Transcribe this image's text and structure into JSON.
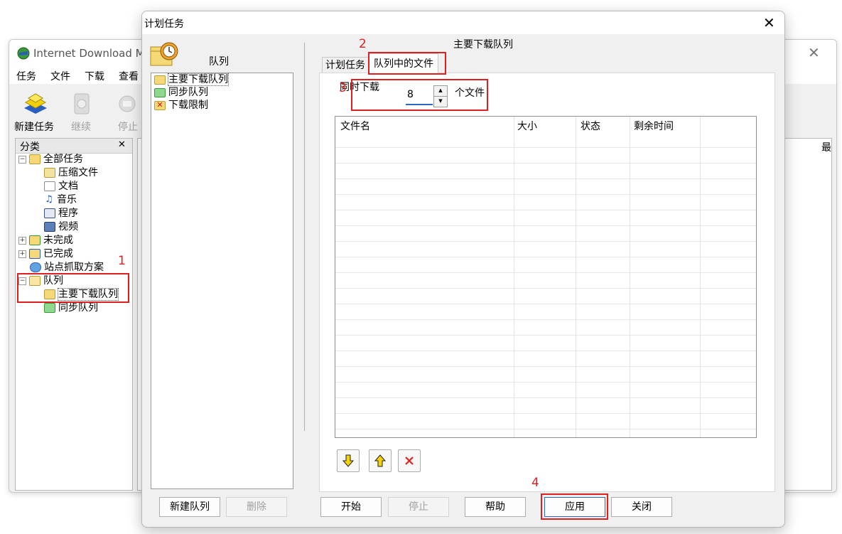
{
  "bg_window": {
    "title": "Internet Download M",
    "menu": [
      "任务",
      "文件",
      "下载",
      "查看"
    ],
    "toolbar": [
      {
        "label": "新建任务",
        "icon": "new-task-icon"
      },
      {
        "label": "继续",
        "icon": "resume-icon"
      },
      {
        "label": "停止",
        "icon": "stop-icon"
      }
    ],
    "category_header": "分类",
    "category_close": "✕",
    "list_head_glyph": "最",
    "tree": [
      {
        "label": "全部任务",
        "icon": "open-folder-icon"
      },
      {
        "label": "压缩文件",
        "icon": "zip-file-icon"
      },
      {
        "label": "文档",
        "icon": "document-icon"
      },
      {
        "label": "音乐",
        "icon": "music-icon"
      },
      {
        "label": "程序",
        "icon": "program-icon"
      },
      {
        "label": "视频",
        "icon": "video-icon"
      },
      {
        "label": "未完成",
        "icon": "unfinished-folder-icon"
      },
      {
        "label": "已完成",
        "icon": "finished-folder-icon"
      },
      {
        "label": "站点抓取方案",
        "icon": "site-grabber-icon"
      },
      {
        "label": "队列",
        "icon": "queue-folder-icon"
      },
      {
        "label": "主要下载队列",
        "icon": "main-queue-icon"
      },
      {
        "label": "同步队列",
        "icon": "sync-queue-icon"
      }
    ]
  },
  "dialog": {
    "title": "计划任务",
    "close_glyph": "✕",
    "queue_label": "队列",
    "queues": [
      {
        "label": "主要下载队列",
        "icon": "main-queue-icon"
      },
      {
        "label": "同步队列",
        "icon": "sync-queue-icon"
      },
      {
        "label": "下载限制",
        "icon": "download-limit-icon"
      }
    ],
    "new_queue_btn": "新建队列",
    "delete_btn": "删除",
    "main_title": "主要下载队列",
    "tabs": [
      "计划任务",
      "队列中的文件"
    ],
    "concurrent_label": "同时下载",
    "concurrent_value": "8",
    "concurrent_unit": "个文件",
    "columns": [
      "文件名",
      "大小",
      "状态",
      "剩余时间"
    ],
    "buttons": {
      "start": "开始",
      "stop": "停止",
      "help": "帮助",
      "apply": "应用",
      "close": "关闭"
    }
  },
  "annotations": [
    "1",
    "2",
    "3",
    "4"
  ],
  "colors": {
    "annotation": "#e02020",
    "focus": "#2a67c7"
  }
}
